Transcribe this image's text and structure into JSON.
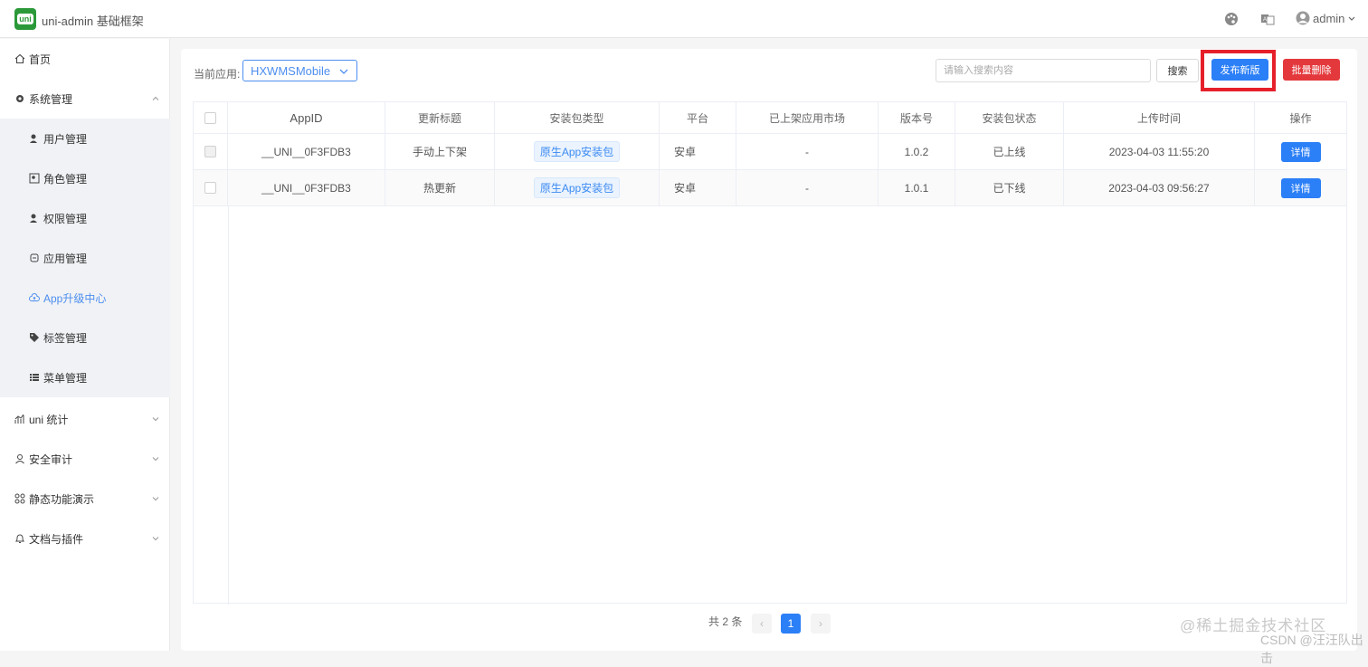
{
  "header": {
    "app_logo_text": "uni",
    "app_title": "uni-admin 基础框架",
    "user_name": "admin"
  },
  "sidebar": {
    "items": [
      {
        "label": "首页",
        "icon": "home-icon"
      },
      {
        "label": "系统管理",
        "icon": "gear-icon",
        "expanded": true
      },
      {
        "label": "用户管理",
        "icon": "user-manage-icon",
        "sub": true
      },
      {
        "label": "角色管理",
        "icon": "role-icon",
        "sub": true
      },
      {
        "label": "权限管理",
        "icon": "permission-icon",
        "sub": true
      },
      {
        "label": "应用管理",
        "icon": "app-manage-icon",
        "sub": true
      },
      {
        "label": "App升级中心",
        "icon": "cloud-upgrade-icon",
        "sub": true,
        "active": true
      },
      {
        "label": "标签管理",
        "icon": "tag-icon",
        "sub": true
      },
      {
        "label": "菜单管理",
        "icon": "menu-list-icon",
        "sub": true
      },
      {
        "label": "uni 统计",
        "icon": "stats-icon"
      },
      {
        "label": "安全审计",
        "icon": "audit-icon"
      },
      {
        "label": "静态功能演示",
        "icon": "grid-icon"
      },
      {
        "label": "文档与插件",
        "icon": "bell-icon"
      }
    ]
  },
  "toolbar": {
    "current_app_label": "当前应用:",
    "current_app_value": "HXWMSMobile",
    "search_placeholder": "请输入搜索内容",
    "search_label": "搜索",
    "publish_label": "发布新版",
    "batch_delete_label": "批量删除"
  },
  "table": {
    "columns": [
      "AppID",
      "更新标题",
      "安装包类型",
      "平台",
      "已上架应用市场",
      "版本号",
      "安装包状态",
      "上传时间",
      "操作"
    ],
    "rows": [
      {
        "appid": "__UNI__0F3FDB3",
        "title": "手动上下架",
        "type": "原生App安装包",
        "platform": "安卓",
        "market": "-",
        "version": "1.0.2",
        "status": "已上线",
        "time": "2023-04-03 11:55:20",
        "action": "详情"
      },
      {
        "appid": "__UNI__0F3FDB3",
        "title": "热更新",
        "type": "原生App安装包",
        "platform": "安卓",
        "market": "-",
        "version": "1.0.1",
        "status": "已下线",
        "time": "2023-04-03 09:56:27",
        "action": "详情"
      }
    ]
  },
  "pagination": {
    "total_text": "共 2 条",
    "current_page": "1",
    "prev": "‹",
    "next": "›"
  },
  "watermark": {
    "line1": "@稀土掘金技术社区",
    "line2": "CSDN @汪汪队出击"
  },
  "colors": {
    "primary": "#2b7ff7",
    "danger": "#e4393c",
    "highlight_box": "#e5202a",
    "active_menu": "#4d8eef"
  }
}
